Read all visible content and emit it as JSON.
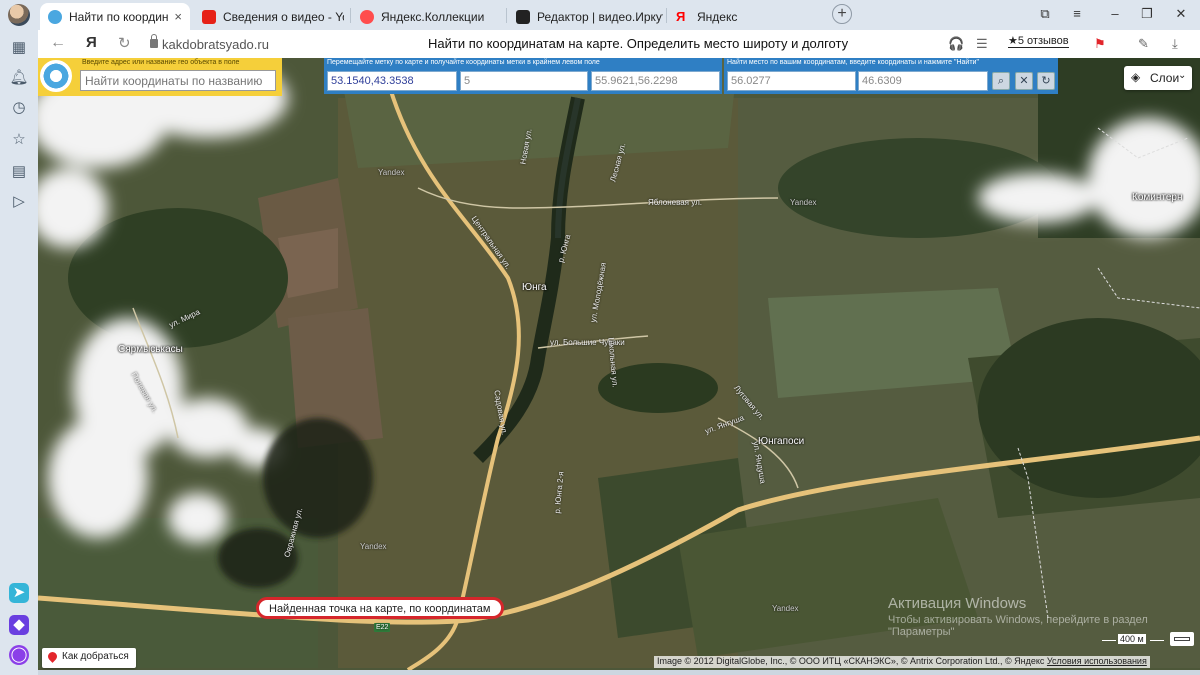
{
  "tabs": [
    {
      "label": "Найти по координатам",
      "active": true,
      "favicon": "kakdobratsyado-icon",
      "color": "#4aa7e0"
    },
    {
      "label": "Сведения о видео - YouTube",
      "favicon": "youtube-icon",
      "color": "#e62117"
    },
    {
      "label": "Яндекс.Коллекции",
      "favicon": "collections-icon",
      "color": "#ff4d4d"
    },
    {
      "label": "Редактор | видео.Иркутск",
      "favicon": "editor-icon",
      "color": "#222222"
    },
    {
      "label": "Яндекс",
      "favicon": "yandex-icon",
      "color": "#ff0000"
    }
  ],
  "address": {
    "domain": "kakdobratsyado.ru",
    "page_title": "Найти по координатам на карте. Определить место широту и долготу",
    "reviews": "★5 отзывов"
  },
  "search_panel": {
    "hint": "Введите адрес или название гео объекта в поле",
    "placeholder": "Найти координаты по названию"
  },
  "marker_panel": {
    "hint": "Перемещайте метку по карте и получайте координаты метки в крайнем левом поле",
    "coords": "53.1540,43.3538",
    "zoom": "5",
    "center": "55.9621,56.2298"
  },
  "find_panel": {
    "hint": "Найти место по вашим координатам, введите координаты и нажмите \"Найти\"",
    "lat": "56.0277",
    "lon": "46.6309"
  },
  "layers_label": "Слои",
  "map_labels": {
    "yunga": "Юнга",
    "yungaposi": "Юнгапоси",
    "sarmyskasy": "Сярмыськасы",
    "komintern": "Коминтерн",
    "yandex": "Yandex",
    "road_badge": "E22"
  },
  "street_labels": [
    "Центральная ул.",
    "р. Юнга",
    "Яблоневая ул.",
    "ул. Молодёжная",
    "ул. Большие Чуваки",
    "ул. Мира",
    "Полевая ул.",
    "ул. Янгуша",
    "р. Юнга 2-я",
    "Новая ул.",
    "Садовая ул.",
    "Лесная ул.",
    "ул. Яндуша",
    "Школьная ул.",
    "Луговая ул.",
    "Овражная ул."
  ],
  "callout": "Найденная точка на карте, по координатам",
  "route_button": "Как добраться",
  "attribution": "Image © 2012 DigitalGlobe, Inc., © ООО ИТЦ «СКАНЭКС», © Antrix Corporation Ltd., © Яндекс",
  "terms": "Условия использования",
  "scale": "400 м",
  "watermark": {
    "title": "Активация Windows",
    "text": "Чтобы активировать Windows, перейдите в раздел \"Параметры\""
  }
}
